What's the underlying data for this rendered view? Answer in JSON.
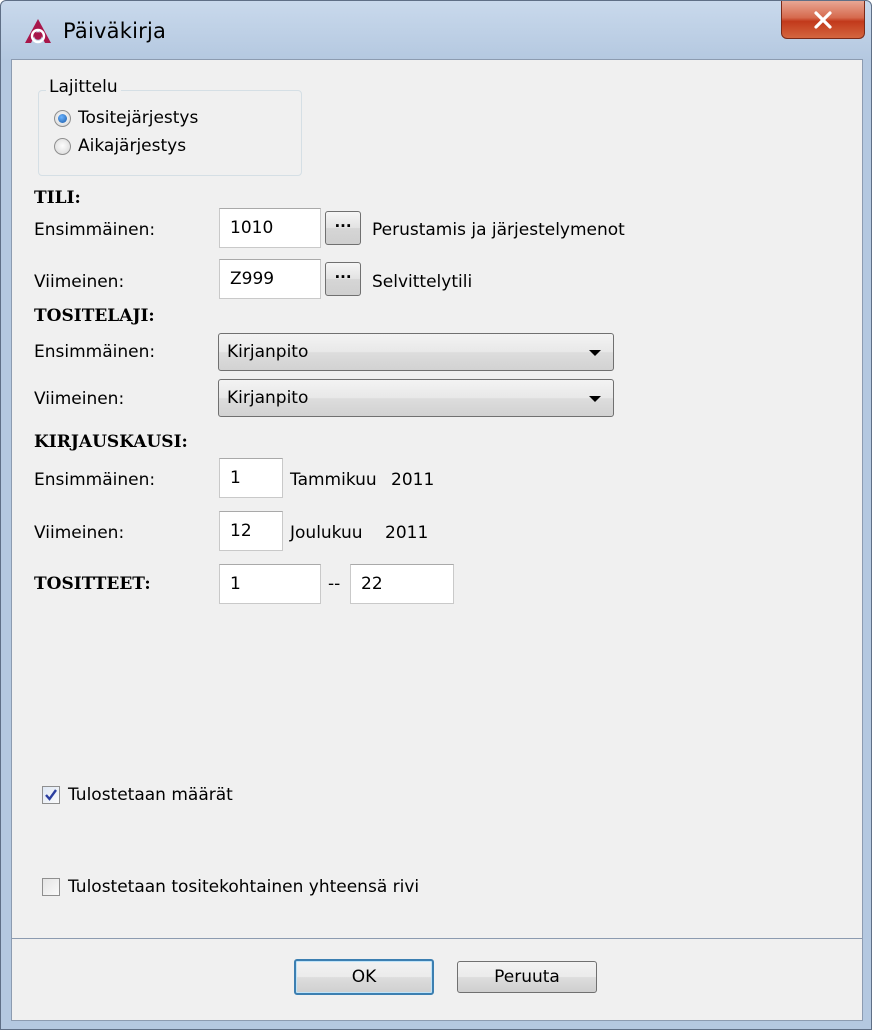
{
  "window": {
    "title": "Päiväkirja"
  },
  "sorting": {
    "group_label": "Lajittelu",
    "option_voucher": "Tositejärjestys",
    "option_time": "Aikajärjestys",
    "selected": "Tositejärjestys"
  },
  "account": {
    "heading": "TILI:",
    "first_label": "Ensimmäinen:",
    "first_value": "1010",
    "first_name": "Perustamis ja järjestelymenot",
    "last_label": "Viimeinen:",
    "last_value": "Z999",
    "last_name": "Selvittelytili",
    "browse_label": "···"
  },
  "voucher_type": {
    "heading": "TOSITELAJI:",
    "first_label": "Ensimmäinen:",
    "first_value": "Kirjanpito",
    "last_label": "Viimeinen:",
    "last_value": "Kirjanpito"
  },
  "period": {
    "heading": "KIRJAUSKAUSI:",
    "first_label": "Ensimmäinen:",
    "first_value": "1",
    "first_month": "Tammikuu",
    "first_year": "2011",
    "last_label": "Viimeinen:",
    "last_value": "12",
    "last_month": "Joulukuu",
    "last_year": "2011"
  },
  "vouchers": {
    "heading": "TOSITTEET:",
    "from_value": "1",
    "separator": "--",
    "to_value": "22"
  },
  "options": {
    "print_amounts": "Tulostetaan määrät",
    "print_amounts_checked": true,
    "print_voucher_totals": "Tulostetaan tositekohtainen yhteensä rivi",
    "print_voucher_totals_checked": false
  },
  "buttons": {
    "ok": "OK",
    "cancel": "Peruuta"
  },
  "colors": {
    "title_bg": "#b4c8e0",
    "close_red": "#c2391b",
    "client_bg": "#f0f0f0",
    "default_border": "#3c7fb1"
  }
}
